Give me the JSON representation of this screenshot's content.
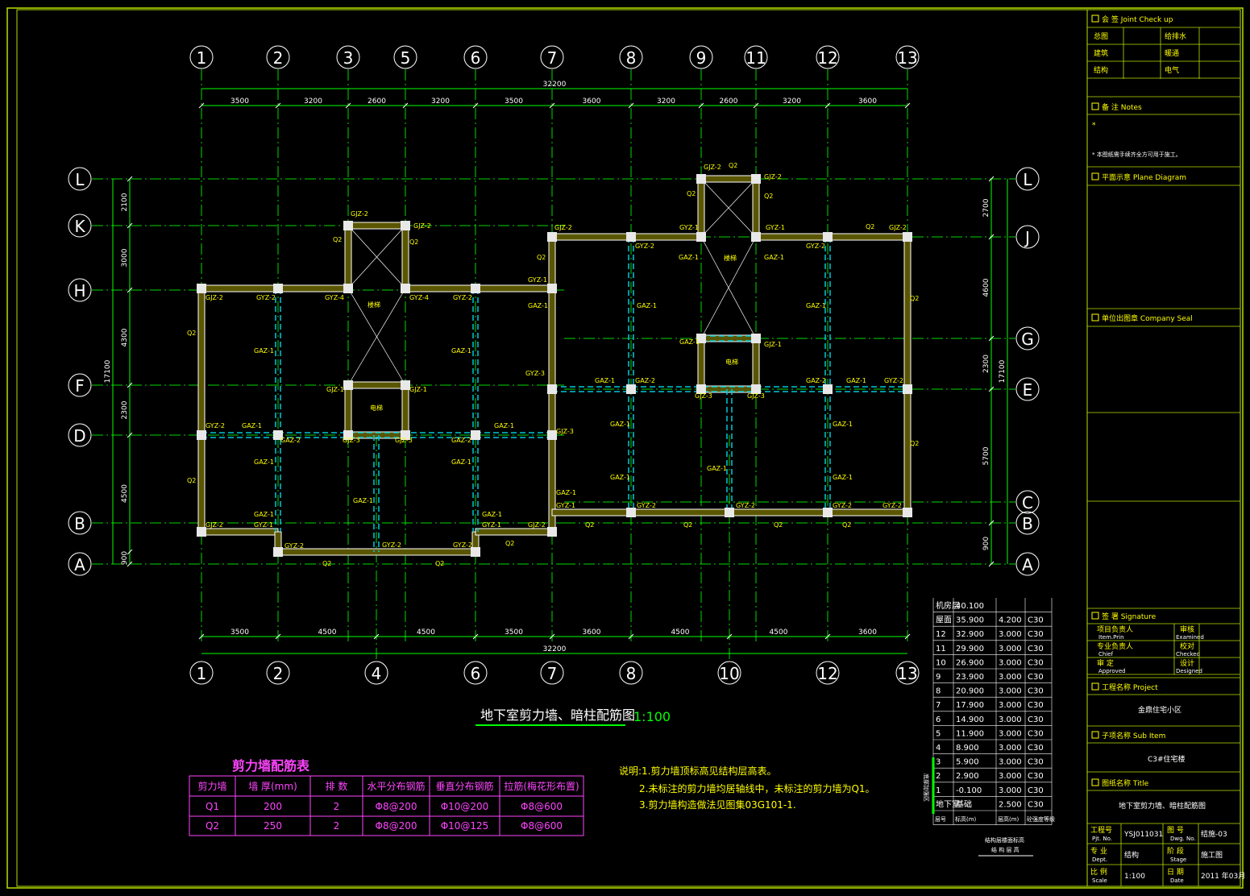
{
  "axes": {
    "top": [
      "1",
      "2",
      "3",
      "5",
      "6",
      "7",
      "8",
      "9",
      "11",
      "12",
      "13"
    ],
    "bottom": [
      "1",
      "2",
      "4",
      "6",
      "7",
      "8",
      "10",
      "12",
      "13"
    ],
    "left": [
      "L",
      "K",
      "H",
      "F",
      "D",
      "B",
      "A"
    ],
    "right": [
      "L",
      "J",
      "G",
      "E",
      "C",
      "B",
      "A"
    ]
  },
  "dims": {
    "top_total": "32200",
    "top_segments": [
      "3500",
      "3200",
      "2600",
      "3200",
      "3500",
      "3600",
      "3200",
      "2600",
      "3200",
      "3600"
    ],
    "bottom_total": "32200",
    "bottom_segments": [
      "3500",
      "4500",
      "4500",
      "3500",
      "3600",
      "4500",
      "4500",
      "3600"
    ],
    "left_total": "17100",
    "left_segments": [
      "2100",
      "3000",
      "4300",
      "2300",
      "4500",
      "900"
    ],
    "right_total": "17100",
    "right_segments": [
      "2700",
      "4600",
      "2300",
      "5700",
      "900"
    ]
  },
  "wall_tags": {
    "gjz2": "GJZ-2",
    "gjz1": "GJZ-1",
    "gjz3": "GJZ-3",
    "gyz1": "GYZ-1",
    "gyz2": "GYZ-2",
    "gyz3": "GYZ-3",
    "gyz4": "GYZ-4",
    "gaz1": "GAZ-1",
    "gaz2": "GAZ-2",
    "q2": "Q2",
    "stair": "楼梯",
    "elev": "电梯"
  },
  "drawing_title": "地下室剪力墙、暗柱配筋图",
  "drawing_scale": "1:100",
  "rebar_table": {
    "title": "剪力墙配筋表",
    "headers": [
      "剪力墙",
      "墙 厚(mm)",
      "排 数",
      "水平分布钢筋",
      "垂直分布钢筋",
      "拉筋(梅花形布置)"
    ],
    "rows": [
      [
        "Q1",
        "200",
        "2",
        "Φ8@200",
        "Φ10@200",
        "Φ8@600"
      ],
      [
        "Q2",
        "250",
        "2",
        "Φ8@200",
        "Φ10@125",
        "Φ8@600"
      ]
    ]
  },
  "notes": [
    "说明:1.剪力墙顶标高见结构层高表。",
    "2.未标注的剪力墙均居轴线中，未标注的剪力墙为Q1。",
    "3.剪力墙构造做法见图集03G101-1."
  ],
  "level_table": {
    "rows": [
      [
        "机房层",
        "40.100",
        "",
        ""
      ],
      [
        "屋面",
        "35.900",
        "4.200",
        "C30"
      ],
      [
        "12",
        "32.900",
        "3.000",
        "C30"
      ],
      [
        "11",
        "29.900",
        "3.000",
        "C30"
      ],
      [
        "10",
        "26.900",
        "3.000",
        "C30"
      ],
      [
        "9",
        "23.900",
        "3.000",
        "C30"
      ],
      [
        "8",
        "20.900",
        "3.000",
        "C30"
      ],
      [
        "7",
        "17.900",
        "3.000",
        "C30"
      ],
      [
        "6",
        "14.900",
        "3.000",
        "C30"
      ],
      [
        "5",
        "11.900",
        "3.000",
        "C30"
      ],
      [
        "4",
        "8.900",
        "3.000",
        "C30"
      ],
      [
        "3",
        "5.900",
        "3.000",
        "C30"
      ],
      [
        "2",
        "2.900",
        "3.000",
        "C30"
      ],
      [
        "1",
        "-0.100",
        "3.000",
        "C30"
      ],
      [
        "地下室",
        "基础",
        "2.500",
        "C30"
      ]
    ],
    "footer": [
      "层号",
      "标高(m)",
      "层高(m)",
      "砼强度等级"
    ],
    "side_label": "底部加强区",
    "caption1": "结构层楼面标高",
    "caption2": "结 构 层 高"
  },
  "title_block": {
    "joint_check": "会 签 Joint Check up",
    "jc_rows": [
      [
        "总图",
        "",
        "给排水",
        ""
      ],
      [
        "建筑",
        "",
        "暖通",
        ""
      ],
      [
        "结构",
        "",
        "电气",
        ""
      ]
    ],
    "notes_head": "备 注 Notes",
    "notes_star": "*",
    "notes_line": "* 本图纸需手续齐全方可用于施工。",
    "plane_head": "平面示意 Plane Diagram",
    "seal_head": "单位出图章 Company Seal",
    "sig_head": "签 署 Signature",
    "sig_rows": [
      [
        "项目负责人",
        "Item.Prin",
        "审核",
        "Examined"
      ],
      [
        "专业负责人",
        "Chief",
        "校对",
        "Checked"
      ],
      [
        "审 定",
        "Approved",
        "设计",
        "Designed"
      ]
    ],
    "project_head": "工程名称 Project",
    "project_name": "金鼎住宅小区",
    "subitem_head": "子项名称 Sub Item",
    "subitem_name": "C3#住宅楼",
    "dwg_head": "图纸名称 Title",
    "dwg_name": "地下室剪力墙、暗柱配筋图",
    "proj_no_label": "工程号",
    "proj_no_label_en": "Pjt. No.",
    "proj_no": "YSJ011031",
    "dwg_no_label": "图 号",
    "dwg_no_label_en": "Dwg. No.",
    "dwg_no": "结施-03",
    "dept_label": "专 业",
    "dept_label_en": "Dept.",
    "dept": "结构",
    "stage_label": "阶 段",
    "stage_label_en": "Stage",
    "stage": "施工图",
    "scale_label": "比 例",
    "scale_label_en": "Scale",
    "scale": "1:100",
    "date_label": "日 期",
    "date_label_en": "Date",
    "date": "2011 年03月"
  },
  "colors": {
    "frame": "#b7e000",
    "grid": "#00ff00",
    "wall_edge": "#ffffff",
    "wall_fill": "#5a5600",
    "column": "#e8e8e8",
    "beam_dash": "#00c8d8",
    "tag": "#ffff00",
    "rebar_table": "#ff44ff",
    "notes": "#ffff00"
  }
}
